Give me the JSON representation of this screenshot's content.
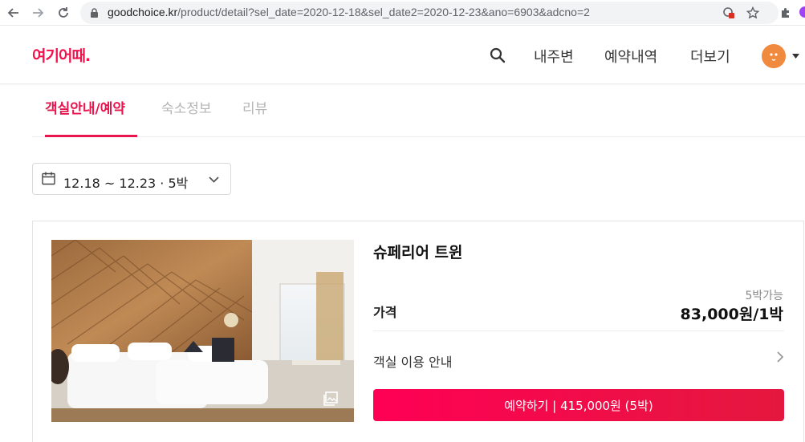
{
  "browser": {
    "url_host": "goodchoice.kr",
    "url_path": "/product/detail?sel_date=2020-12-18&sel_date2=2020-12-23&ano=6903&adcno=2"
  },
  "header": {
    "logo": "여기어때.",
    "nav": [
      "내주변",
      "예약내역",
      "더보기"
    ]
  },
  "tabs": [
    {
      "label": "객실안내/예약",
      "active": true
    },
    {
      "label": "숙소정보",
      "active": false
    },
    {
      "label": "리뷰",
      "active": false
    }
  ],
  "date_selector": {
    "label": "12.18 ~ 12.23 · 5박"
  },
  "room": {
    "name": "슈페리어 트윈",
    "price_label": "가격",
    "availability": "5박가능",
    "price": "83,000원/1박",
    "info_label": "객실 이용 안내",
    "book_button": "예약하기 | 415,000원 (5박)"
  },
  "colors": {
    "brand": "#f2114c",
    "accent": "#e8154e"
  }
}
